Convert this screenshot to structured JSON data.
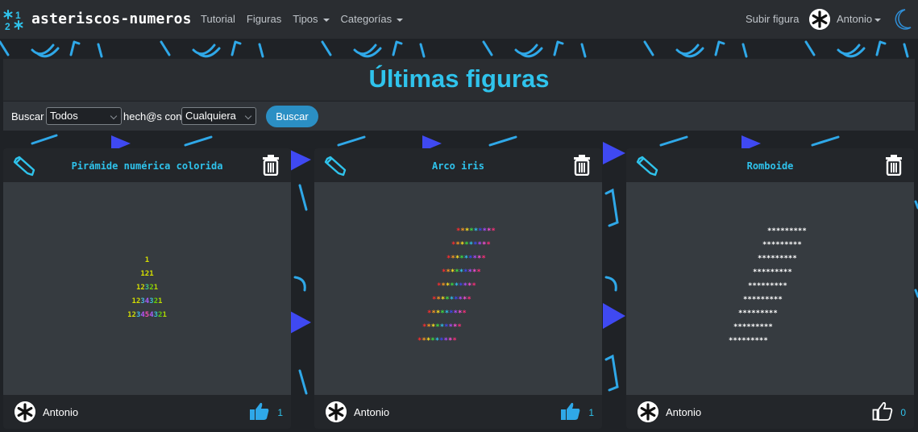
{
  "navbar": {
    "logo_digits": [
      "1",
      "2"
    ],
    "brand": "asteriscos-numeros",
    "links": [
      {
        "label": "Tutorial",
        "dropdown": false
      },
      {
        "label": "Figuras",
        "dropdown": false
      },
      {
        "label": "Tipos",
        "dropdown": true
      },
      {
        "label": "Categorías",
        "dropdown": true
      }
    ],
    "upload_label": "Subir figura",
    "user_name": "Antonio",
    "theme_icon": "moon-icon"
  },
  "page": {
    "title": "Últimas figuras"
  },
  "filter": {
    "search_label": "Buscar",
    "type_value": "Todos",
    "made_label": "hech@s con",
    "category_value": "Cualquiera",
    "button_label": "Buscar"
  },
  "colors": {
    "accent": "#2fc3ec",
    "button": "#2b8fc4",
    "background": "#1f2226",
    "card": "#23262a",
    "card_body": "#363b40",
    "deco_cyan": "#2fa8e8",
    "deco_blue": "#3f49f2"
  },
  "cards": [
    {
      "title": "Pirámide numérica colorida",
      "author": "Antonio",
      "likes": "1",
      "liked": true,
      "figure_lines": [
        "1",
        "121",
        "12321",
        "1234321",
        "123454321"
      ]
    },
    {
      "title": "Arco iris",
      "author": "Antonio",
      "likes": "1",
      "liked": true,
      "figure_lines": [
        "*********",
        "*********",
        "*********",
        "*********",
        "*********",
        "*********",
        "*********",
        "*********",
        "*********"
      ]
    },
    {
      "title": "Romboide",
      "author": "Antonio",
      "likes": "0",
      "liked": false,
      "figure_lines": [
        "*********",
        "*********",
        "*********",
        "*********",
        "*********",
        "*********",
        "*********",
        "*********",
        "*********"
      ]
    }
  ]
}
